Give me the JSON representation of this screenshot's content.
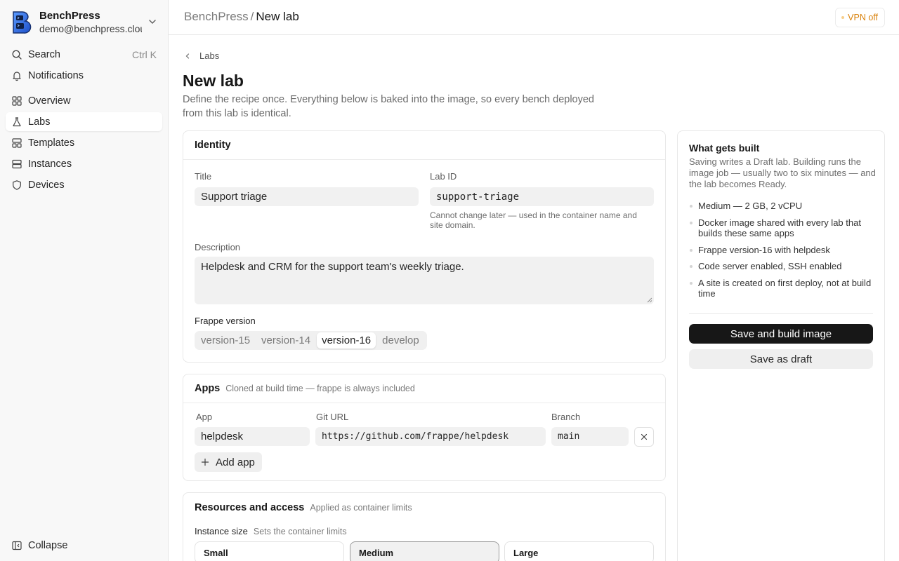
{
  "account": {
    "name": "BenchPress",
    "email": "demo@benchpress.cloud"
  },
  "nav": {
    "search": {
      "label": "Search",
      "shortcut": "Ctrl K"
    },
    "notifications": "Notifications",
    "overview": "Overview",
    "labs": "Labs",
    "templates": "Templates",
    "instances": "Instances",
    "devices": "Devices",
    "collapse": "Collapse"
  },
  "header": {
    "root": "BenchPress",
    "separator": "/",
    "current": "New lab",
    "vpn_status": "VPN off"
  },
  "page": {
    "back": "Labs",
    "title": "New lab",
    "description": "Define the recipe once. Everything below is baked into the image, so every bench deployed from this lab is identical."
  },
  "identity": {
    "heading": "Identity",
    "title_label": "Title",
    "title_value": "Support triage",
    "lab_id_label": "Lab ID",
    "lab_id_value": "support-triage",
    "lab_id_hint": "Cannot change later — used in the container name and site domain.",
    "description_label": "Description",
    "description_value": "Helpdesk and CRM for the support team's weekly triage.",
    "frappe_label": "Frappe version",
    "frappe_options": [
      "version-15",
      "version-14",
      "version-16",
      "develop"
    ],
    "frappe_selected": "version-16"
  },
  "apps": {
    "heading": "Apps",
    "subheading": "Cloned at build time — frappe is always included",
    "columns": {
      "app": "App",
      "git": "Git URL",
      "branch": "Branch"
    },
    "rows": [
      {
        "app": "helpdesk",
        "git": "https://github.com/frappe/helpdesk",
        "branch": "main"
      }
    ],
    "add_label": "Add app"
  },
  "resources": {
    "heading": "Resources and access",
    "subheading": "Applied as container limits",
    "size_label": "Instance size",
    "size_hint": "Sets the container limits",
    "sizes": [
      "Small",
      "Medium",
      "Large"
    ],
    "selected_size": "Medium"
  },
  "summary": {
    "title": "What gets built",
    "description": "Saving writes a Draft lab. Building runs the image job — usually two to six minutes — and the lab becomes Ready.",
    "items": [
      "Medium — 2 GB, 2 vCPU",
      "Docker image shared with every lab that builds these same apps",
      "Frappe version-16 with helpdesk",
      "Code server enabled, SSH enabled",
      "A site is created on first deploy, not at build time"
    ],
    "primary_action": "Save and build image",
    "secondary_action": "Save as draft"
  },
  "colors": {
    "accent": "#171717",
    "vpn_warning": "#d9820c",
    "logo_blue": "#2f6fe4"
  }
}
